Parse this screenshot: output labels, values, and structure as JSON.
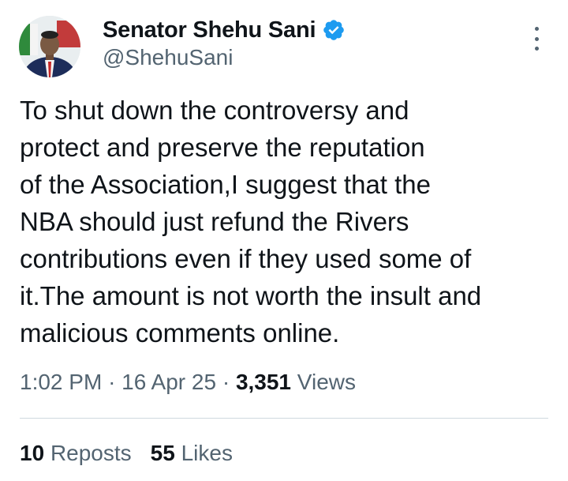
{
  "author": {
    "display_name": "Senator Shehu Sani",
    "handle": "@ShehuSani",
    "verified": true,
    "verified_badge_color": "#1d9bf0"
  },
  "tweet": {
    "text": "To shut down the controversy and\nprotect and preserve the reputation\nof the Association,I suggest that the\nNBA should just refund the Rivers\ncontributions even if they used some of\nit.The amount is not worth the insult and\nmalicious comments online."
  },
  "meta": {
    "time": "1:02 PM",
    "separator": "·",
    "date": "16 Apr 25",
    "views_count": "3,351",
    "views_label": "Views"
  },
  "engagement": {
    "reposts_count": "10",
    "reposts_label": "Reposts",
    "likes_count": "55",
    "likes_label": "Likes"
  },
  "icons": {
    "more": "more-vertical-icon",
    "verified": "verified-badge-icon"
  },
  "colors": {
    "text_primary": "#0f1419",
    "text_secondary": "#536471",
    "divider": "#cfd9de"
  }
}
